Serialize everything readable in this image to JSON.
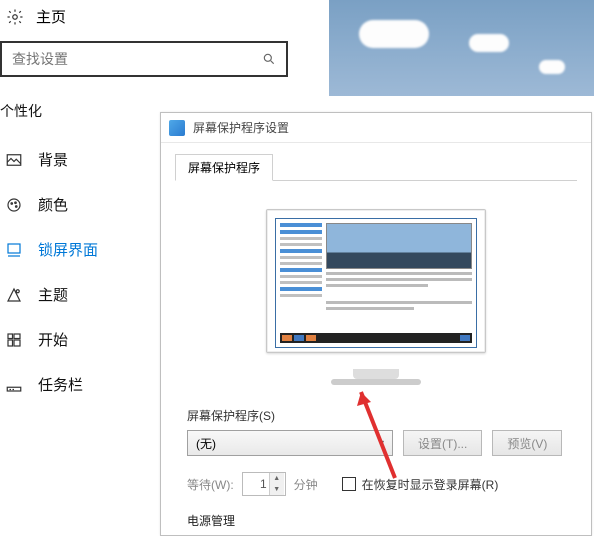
{
  "home_label": "主页",
  "search_placeholder": "查找设置",
  "category": "个性化",
  "nav": {
    "background": "背景",
    "color": "颜色",
    "lockscreen": "锁屏界面",
    "theme": "主题",
    "start": "开始",
    "taskbar": "任务栏"
  },
  "dialog": {
    "title": "屏幕保护程序设置",
    "tab": "屏幕保护程序",
    "section_label": "屏幕保护程序(S)",
    "select_value": "(无)",
    "btn_settings": "设置(T)...",
    "btn_preview": "预览(V)",
    "wait_label": "等待(W):",
    "wait_value": "1",
    "wait_unit": "分钟",
    "chk_label": "在恢复时显示登录屏幕(R)",
    "power_section": "电源管理"
  }
}
